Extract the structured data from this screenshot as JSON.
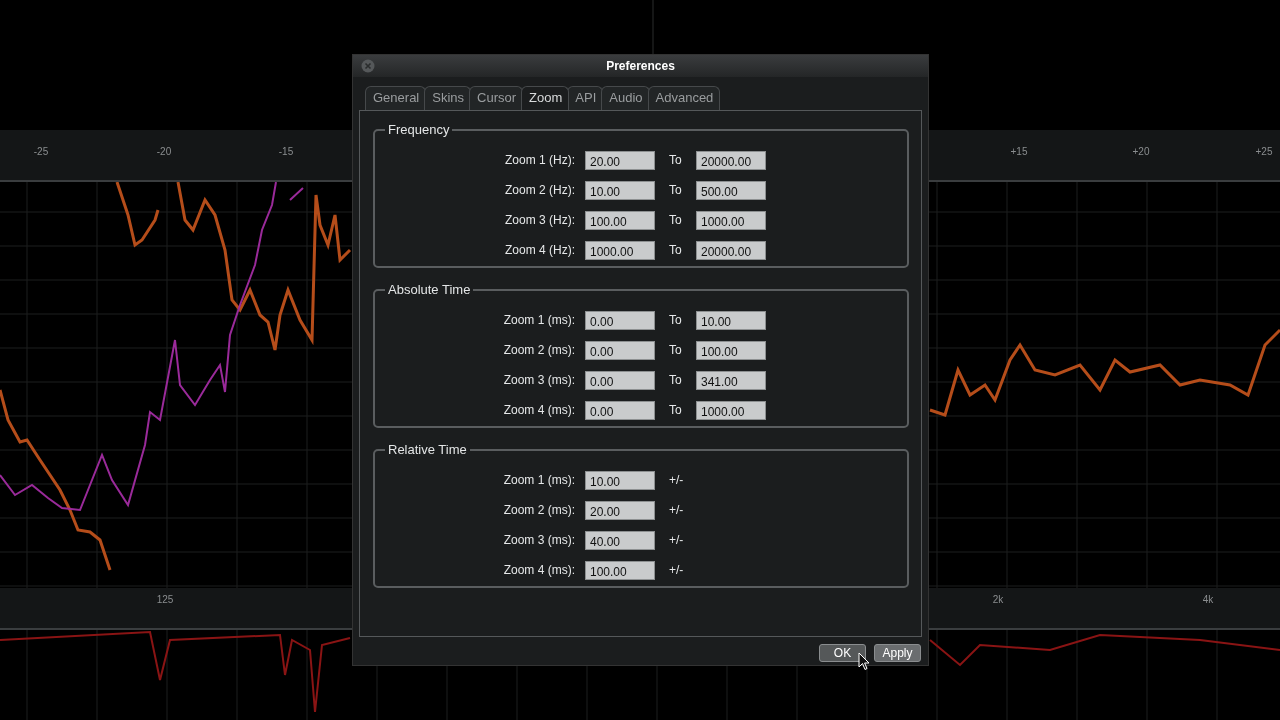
{
  "background": {
    "top_axis_labels": [
      "-25",
      "-20",
      "-15",
      "+15",
      "+20",
      "+25"
    ],
    "bottom_axis_labels": [
      "125",
      "2k",
      "4k"
    ]
  },
  "dialog": {
    "title": "Preferences",
    "tabs": [
      {
        "label": "General",
        "selected": false
      },
      {
        "label": "Skins",
        "selected": false
      },
      {
        "label": "Cursor",
        "selected": false
      },
      {
        "label": "Zoom",
        "selected": true
      },
      {
        "label": "API",
        "selected": false
      },
      {
        "label": "Audio",
        "selected": false
      },
      {
        "label": "Advanced",
        "selected": false
      }
    ],
    "groups": [
      {
        "title": "Frequency",
        "kind": "range",
        "rows": [
          {
            "label": "Zoom 1 (Hz):",
            "from": "20.00",
            "separator": "To",
            "to": "20000.00"
          },
          {
            "label": "Zoom 2 (Hz):",
            "from": "10.00",
            "separator": "To",
            "to": "500.00"
          },
          {
            "label": "Zoom 3 (Hz):",
            "from": "100.00",
            "separator": "To",
            "to": "1000.00"
          },
          {
            "label": "Zoom 4 (Hz):",
            "from": "1000.00",
            "separator": "To",
            "to": "20000.00"
          }
        ]
      },
      {
        "title": "Absolute Time",
        "kind": "range",
        "rows": [
          {
            "label": "Zoom 1 (ms):",
            "from": "0.00",
            "separator": "To",
            "to": "10.00"
          },
          {
            "label": "Zoom 2 (ms):",
            "from": "0.00",
            "separator": "To",
            "to": "100.00"
          },
          {
            "label": "Zoom 3 (ms):",
            "from": "0.00",
            "separator": "To",
            "to": "341.00"
          },
          {
            "label": "Zoom 4 (ms):",
            "from": "0.00",
            "separator": "To",
            "to": "1000.00"
          }
        ]
      },
      {
        "title": "Relative Time",
        "kind": "offset",
        "rows": [
          {
            "label": "Zoom 1 (ms):",
            "from": "10.00",
            "separator": "+/-"
          },
          {
            "label": "Zoom 2 (ms):",
            "from": "20.00",
            "separator": "+/-"
          },
          {
            "label": "Zoom 3 (ms):",
            "from": "40.00",
            "separator": "+/-"
          },
          {
            "label": "Zoom 4 (ms):",
            "from": "100.00",
            "separator": "+/-"
          }
        ]
      }
    ],
    "buttons": [
      "OK",
      "Apply"
    ]
  }
}
